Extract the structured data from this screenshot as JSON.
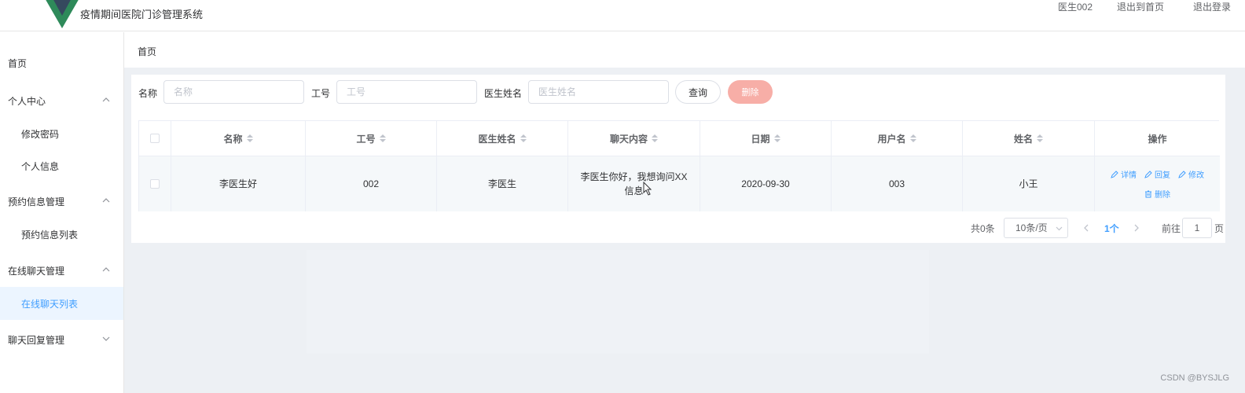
{
  "app": {
    "title": "疫情期间医院门诊管理系统",
    "brand_color": "#2e8a5a"
  },
  "header": {
    "user": "医生002",
    "back_home": "退出到首页",
    "logout": "退出登录"
  },
  "sidebar": {
    "items": [
      {
        "label": "首页"
      },
      {
        "label": "个人中心"
      },
      {
        "label": "修改密码"
      },
      {
        "label": "个人信息"
      },
      {
        "label": "预约信息管理"
      },
      {
        "label": "预约信息列表"
      },
      {
        "label": "在线聊天管理"
      },
      {
        "label": "在线聊天列表"
      },
      {
        "label": "聊天回复管理"
      }
    ]
  },
  "breadcrumb": "首页",
  "search": {
    "name_label": "名称",
    "name_placeholder": "名称",
    "job_label": "工号",
    "job_placeholder": "工号",
    "doctor_label": "医生姓名",
    "doctor_placeholder": "医生姓名",
    "query_btn": "查询",
    "delete_btn": "删除"
  },
  "table": {
    "columns": [
      "名称",
      "工号",
      "医生姓名",
      "聊天内容",
      "日期",
      "用户名",
      "姓名",
      "操作"
    ],
    "rows": [
      {
        "name": "李医生好",
        "job_no": "002",
        "doctor": "李医生",
        "content": "李医生你好，我想询问XX信息",
        "date": "2020-09-30",
        "username": "003",
        "real_name": "小王"
      }
    ],
    "actions": {
      "detail": "详情",
      "reply": "回复",
      "edit": "修改",
      "delete": "删除"
    }
  },
  "pagination": {
    "total": "共0条",
    "page_size": "10条/页",
    "current": "1个",
    "goto": "前往",
    "goto_value": "1",
    "page_suffix": "页"
  },
  "watermark": "CSDN @BYSJLG"
}
